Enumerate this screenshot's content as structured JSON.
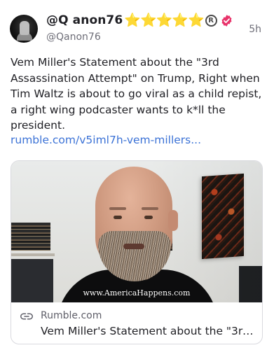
{
  "author": {
    "display_name": "@Q anon76",
    "name_emojis": [
      "⭐",
      "⭐",
      "⭐",
      "⭐",
      "⭐"
    ],
    "registered_symbol": "R",
    "handle": "@Qanon76",
    "verified_icon": "verified-badge-icon",
    "avatar_icon": "avatar-image"
  },
  "timestamp": "5h",
  "post": {
    "text": "Vem Miller's Statement about the \"3rd Assassination Attempt\" on Trump, Right when Tim Waltz is about to go viral as a child repist, a right wing podcaster wants to k*ll the president.",
    "link_text": "rumble.com/v5iml7h-vem-millers..."
  },
  "card": {
    "watermark": "www.AmericaHappens.com",
    "domain": "Rumble.com",
    "title": "Vem Miller's Statement about the \"3rd...",
    "link_icon": "link-icon"
  },
  "colors": {
    "link": "#3b72d6",
    "star": "#f5b90f",
    "verified": "#e8336a",
    "muted": "#6e6e78"
  }
}
